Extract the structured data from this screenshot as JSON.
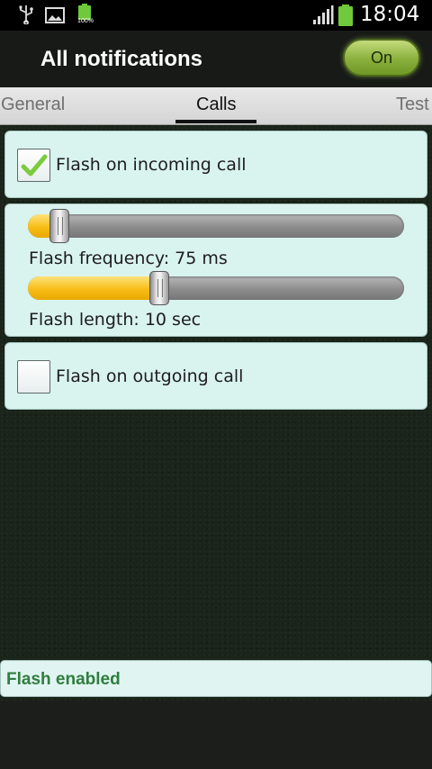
{
  "status_bar": {
    "time": "18:04",
    "battery_small_label": "100%",
    "icons": [
      "usb-icon",
      "image-icon",
      "battery-small-icon",
      "signal-icon",
      "battery-icon"
    ],
    "battery_color": "#6fc93b"
  },
  "header": {
    "title": "All notifications",
    "toggle_label": "On"
  },
  "tabs": [
    {
      "label": "General",
      "selected": false
    },
    {
      "label": "Calls",
      "selected": true
    },
    {
      "label": "Test",
      "selected": false
    }
  ],
  "calls": {
    "incoming": {
      "label": "Flash on incoming call",
      "checked": true
    },
    "frequency": {
      "caption": "Flash frequency: 75 ms",
      "level": 0.06
    },
    "length": {
      "caption": "Flash length: 10 sec",
      "level": 0.34
    },
    "outgoing": {
      "label": "Flash on outgoing call",
      "checked": false
    }
  },
  "status": {
    "text": "Flash enabled"
  },
  "colors": {
    "accent_green": "#8ab03c",
    "slider_fill": "#f7bd17",
    "card_bg": "#d9f3ee",
    "status_text": "#2f7d3f"
  }
}
